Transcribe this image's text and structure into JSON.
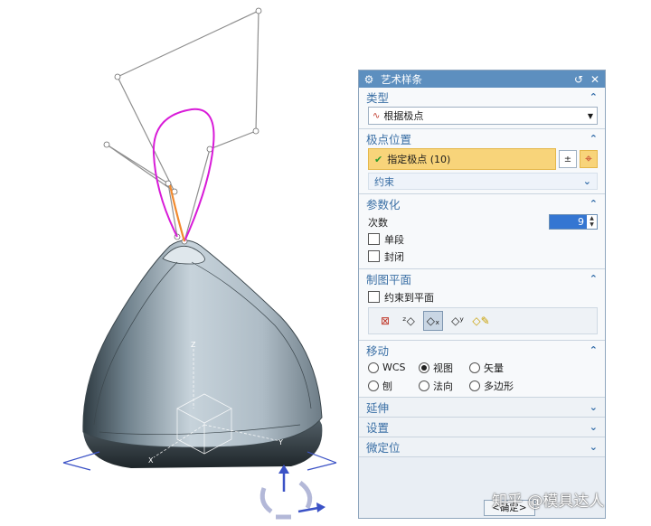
{
  "dialog": {
    "title": "艺术样条",
    "title_icons": [
      "gear-icon",
      "reset-icon",
      "close-icon"
    ],
    "sections": {
      "type": {
        "header": "类型",
        "selected": "根据极点"
      },
      "pole_position": {
        "header": "极点位置",
        "specify_label": "指定极点 (10)",
        "constraint_label": "约束"
      },
      "parameterization": {
        "header": "参数化",
        "degree_label": "次数",
        "degree_value": "9",
        "single_segment_label": "单段",
        "closed_label": "封闭",
        "single_segment_checked": false,
        "closed_checked": false
      },
      "drawing_plane": {
        "header": "制图平面",
        "constrain_label": "约束到平面",
        "constrain_checked": false,
        "plane_icons": [
          "inferred-plane-icon",
          "zc-plane-icon",
          "xc-plane-icon",
          "yc-plane-icon",
          "custom-plane-icon"
        ],
        "active_plane_index": 2
      },
      "move": {
        "header": "移动",
        "options": [
          "WCS",
          "视图",
          "矢量",
          "刨",
          "法向",
          "多边形"
        ],
        "selected": "视图"
      },
      "extend": {
        "header": "延伸"
      },
      "settings": {
        "header": "设置"
      },
      "fine_tune": {
        "header": "微定位"
      }
    },
    "footer": {
      "ok_label": "<确定>"
    }
  },
  "watermark": "知乎 @模具达人",
  "colors": {
    "titlebar": "#5d8fbf",
    "section_header": "#3a6fa5",
    "highlight": "#f8d47a",
    "spline": "#d81bd8",
    "control_polygon": "#8f8f8f",
    "shape_body": "#aebcc6"
  }
}
